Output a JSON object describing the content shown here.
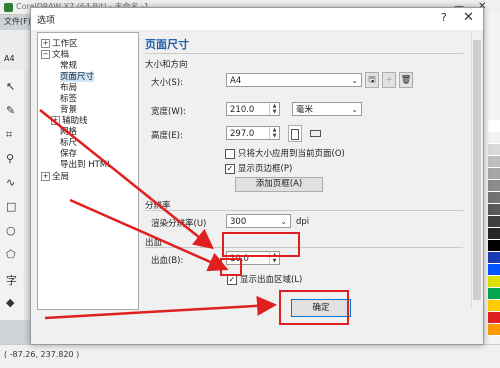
{
  "app": {
    "title": "CorelDRAW X7 (64-Bit) - 未命名 -1",
    "menu_file": "文件(F)",
    "paper_size": "A4",
    "status_coord": "( -87.26, 237.820 )"
  },
  "dialog": {
    "title": "选项",
    "help": "?",
    "close": "✕",
    "ok_label": "确定"
  },
  "tree": {
    "workspace": "工作区",
    "document": "文档",
    "general": "常规",
    "page_size": "页面尺寸",
    "layout": "布局",
    "labels": "标签",
    "background": "背景",
    "guidelines": "辅助线",
    "grid": "网格",
    "rulers": "标尺",
    "save": "保存",
    "export_html": "导出到 HTML",
    "global": "全局"
  },
  "page": {
    "title": "页面尺寸",
    "size_section": "大小和方向",
    "size_label": "大小(S):",
    "size_value": "A4",
    "width_label": "宽度(W):",
    "width_value": "210.0",
    "unit_value": "毫米",
    "height_label": "高度(E):",
    "height_value": "297.0",
    "apply_current_only": "只将大小应用到当前页面(O)",
    "show_page_border": "显示页边框(P)",
    "add_page_frame": "添加页框(A)",
    "resolution_section": "分辨率",
    "render_resolution_label": "渲染分辨率(U)",
    "resolution_value": "300",
    "resolution_unit": "dpi",
    "bleed_section": "出血",
    "bleed_label": "出血(B):",
    "bleed_value": "10.0",
    "show_bleed_area": "显示出血区域(L)"
  },
  "palette_colors": [
    "#ffffff",
    "#f2f2f2",
    "#d9d9d9",
    "#bfbfbf",
    "#a6a6a6",
    "#8c8c8c",
    "#737373",
    "#595959",
    "#404040",
    "#262626",
    "#000000",
    "#1a3bb5",
    "#0055ff",
    "#e0e000",
    "#00a650",
    "#ffcc00",
    "#e02020",
    "#ff9900"
  ]
}
